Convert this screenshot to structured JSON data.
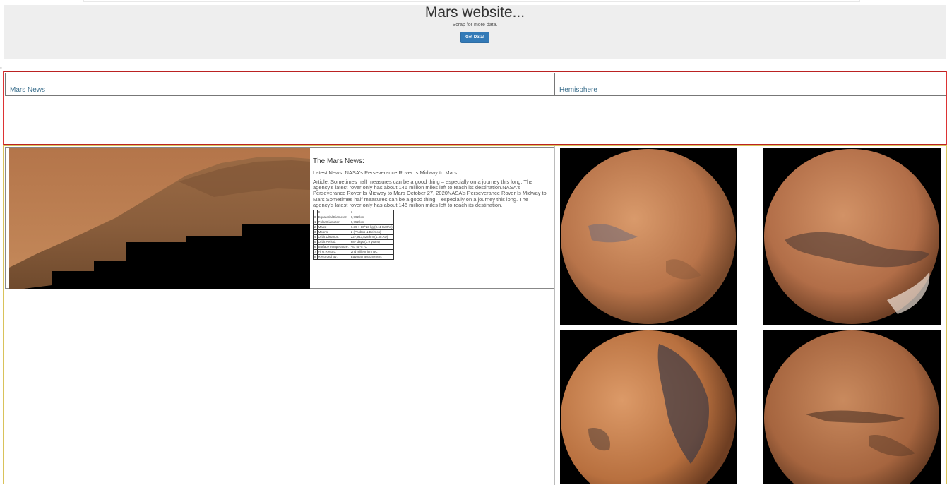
{
  "jumbotron": {
    "title": "Mars website...",
    "subtitle": "Scrap for more data.",
    "button_label": "Get Data!"
  },
  "headers": {
    "news": "Mars News",
    "hemisphere": "Hemisphere"
  },
  "news": {
    "heading": "The Mars News:",
    "latest_prefix": "Latest News: ",
    "latest_title": "NASA's Perseverance Rover Is Midway to Mars",
    "article_prefix": "Article: ",
    "article": "Sometimes half measures can be a good thing – especially on a journey this long. The agency's latest rover only has about 146 million miles left to reach its destination.NASA's Perseverance Rover Is Midway to Mars October 27, 2020NASA's Perseverance Rover Is Midway to Mars Sometimes half measures can be a good thing – especially on a journey this long. The agency's latest rover only has about 146 million miles left to reach its destination."
  },
  "facts_table": {
    "header": [
      "0",
      "1"
    ],
    "rows": [
      [
        "0",
        "Equatorial Diameter:",
        "6,792 km"
      ],
      [
        "1",
        "Polar Diameter:",
        "6,752 km"
      ],
      [
        "2",
        "Mass:",
        "6.39 × 10^23 kg (0.11 Earths)"
      ],
      [
        "3",
        "Moons:",
        "2 (Phobos & Deimos)"
      ],
      [
        "4",
        "Orbit Distance:",
        "227,943,824 km (1.38 AU)"
      ],
      [
        "5",
        "Orbit Period:",
        "687 days (1.9 years)"
      ],
      [
        "6",
        "Surface Temperature:",
        "-87 to -5 °C"
      ],
      [
        "7",
        "First Record:",
        "2nd millennium BC"
      ],
      [
        "8",
        "Recorded By:",
        "Egyptian astronomers"
      ]
    ]
  },
  "misc": {
    "tiny_mark": "::"
  }
}
